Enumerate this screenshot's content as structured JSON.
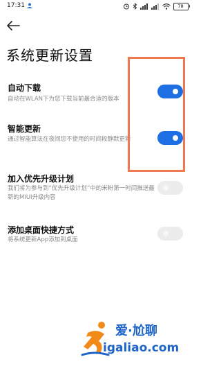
{
  "status_bar": {
    "time": "17:31",
    "battery": "78"
  },
  "page": {
    "title": "系统更新设置"
  },
  "settings": [
    {
      "title": "自动下载",
      "desc": "自动在WLAN下为您下载当前最合适的版本",
      "enabled": true
    },
    {
      "title": "智能更新",
      "desc": "通过智能算法在夜间您不使用的时间段静默更新",
      "enabled": true
    },
    {
      "title": "加入优先升级计划",
      "desc": "我们将为参与到“优先升级计划”中的米粉第一时间推送最新的MIUI升级内容",
      "enabled": false
    },
    {
      "title": "添加桌面快捷方式",
      "desc": "将系统更新App添加到桌面",
      "enabled": false
    }
  ],
  "watermark": {
    "main": "爱·尬聊",
    "sub": "igaliao.com"
  },
  "colors": {
    "toggle_on": "#1e6fe3",
    "toggle_off": "#ececec",
    "highlight": "#ef7a52",
    "watermark": "#1f66c8"
  }
}
